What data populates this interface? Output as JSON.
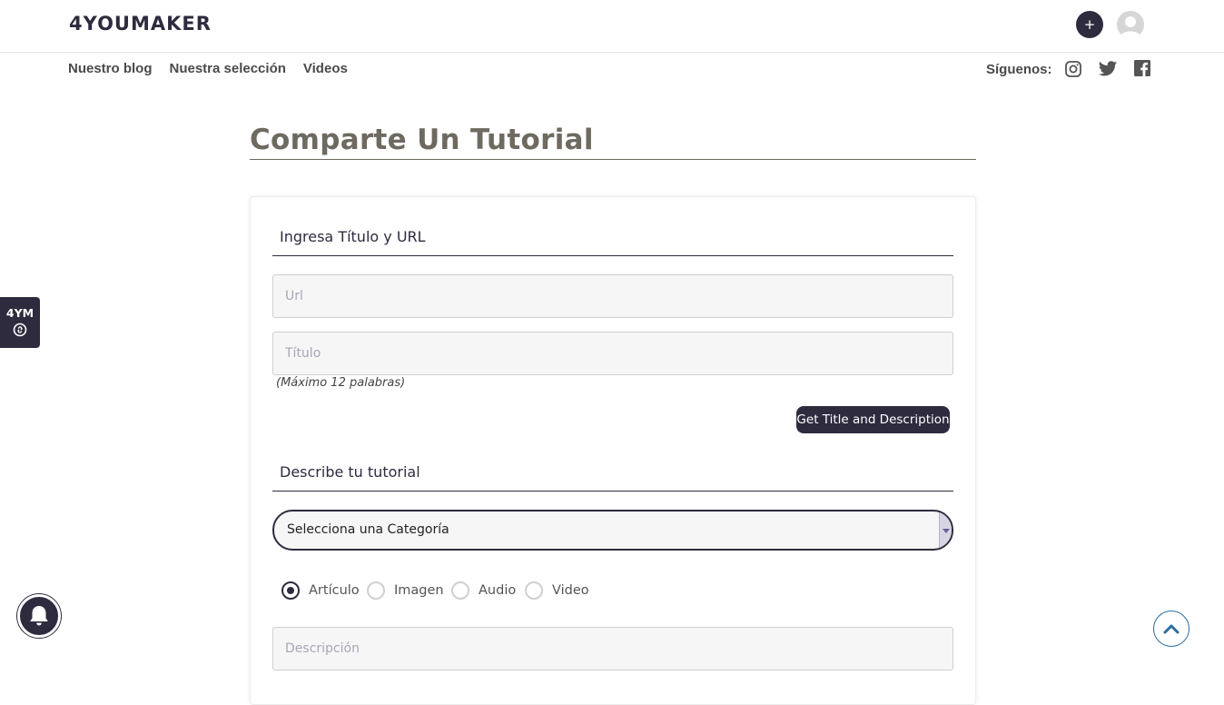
{
  "header": {
    "logo": "4YOUMAKER",
    "plus_label": "+"
  },
  "nav": {
    "items": [
      "Nuestro blog",
      "Nuestra selección",
      "Videos"
    ],
    "follow_label": "Síguenos:"
  },
  "page": {
    "title": "Comparte Un Tutorial"
  },
  "form": {
    "section1": "Ingresa Título y URL",
    "url_placeholder": "Url",
    "title_placeholder": "Título",
    "title_hint": "(Máximo 12 palabras)",
    "get_button": "Get Title and Description",
    "section2": "Describe tu tutorial",
    "category_selected": "Selecciona una Categoría",
    "types": [
      "Artículo",
      "Imagen",
      "Audio",
      "Video"
    ],
    "selected_type": "Artículo",
    "description_placeholder": "Descripción"
  },
  "side_tab": {
    "label": "4YM"
  },
  "colors": {
    "brand": "#2e2b3f",
    "title": "#6e6a60",
    "accent_blue": "#2b6d9c"
  }
}
